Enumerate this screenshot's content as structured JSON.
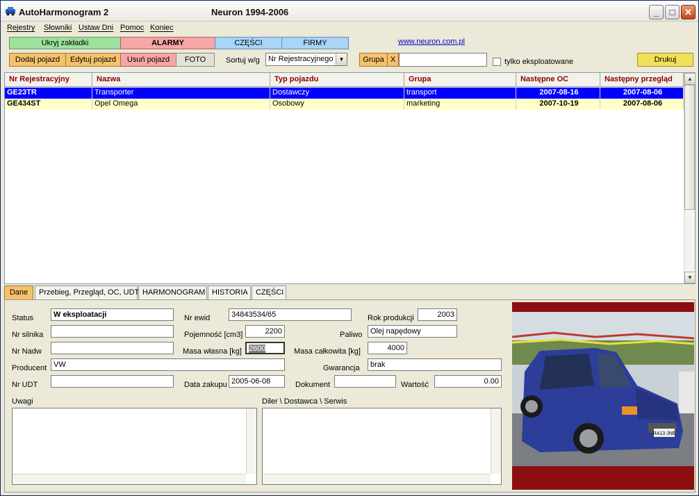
{
  "title": {
    "app": "AutoHarmonogram 2",
    "company": "Neuron 1994-2006"
  },
  "window_controls": {
    "minimize": "_",
    "maximize": "□",
    "close": "✕"
  },
  "menu": [
    "Rejestry",
    "Słowniki",
    "Ustaw Dni",
    "Pomoc",
    "Koniec"
  ],
  "top_buttons": {
    "hide_tabs": "Ukryj zakładki",
    "alarms": "ALARMY",
    "parts": "CZĘŚCI",
    "firms": "FIRMY"
  },
  "link": "www.neuron.com.pl",
  "toolbar": {
    "add": "Dodaj pojazd",
    "edit": "Edytuj pojazd",
    "delete": "Usuń pojazd",
    "photo": "FOTO",
    "sort_label": "Sortuj w/g",
    "sort_value": "Nr Rejestracyjnego",
    "group_button": "Grupa",
    "group_clear": "X",
    "group_value": "",
    "only_operated": "tylko eksploatowane",
    "print": "Drukuj"
  },
  "table": {
    "columns": [
      "Nr Rejestracyjny",
      "Nazwa",
      "Typ pojazdu",
      "Grupa",
      "Następne OC",
      "Następny przegląd"
    ],
    "rows": [
      [
        "GE23TR",
        "Transporter",
        "Dostawczy",
        "transport",
        "2007-08-16",
        "2007-08-06"
      ],
      [
        "GE434ST",
        "Opel Omega",
        "Osobowy",
        "marketing",
        "2007-10-19",
        "2007-08-06"
      ]
    ],
    "selected_row": 0
  },
  "tabs": [
    "Dane",
    "Przebieg, Przegląd, OC, UDT",
    "HARMONOGRAM",
    "HISTORIA",
    "CZĘŚCI"
  ],
  "active_tab": 0,
  "form": {
    "status_label": "Status",
    "status": "W eksploatacji",
    "nr_ewid_label": "Nr ewid",
    "nr_ewid": "34843534/65",
    "rok_label": "Rok produkcji",
    "rok": "2003",
    "nr_silnika_label": "Nr silnika",
    "nr_silnika": "",
    "pojemnosc_label": "Pojemność [cm3]",
    "pojemnosc": "2200",
    "paliwo_label": "Paliwo",
    "paliwo": "Olej napędowy",
    "nr_nadw_label": "Nr Nadw",
    "nr_nadw": "",
    "masa_wlasna_label": "Masa własna [kg]",
    "masa_wlasna": "2600",
    "masa_calk_label": "Masa całkowita [kg]",
    "masa_calk": "4000",
    "producent_label": "Producent",
    "producent": "VW",
    "gwarancja_label": "Gwarancja",
    "gwarancja": "brak",
    "nr_udt_label": "Nr UDT",
    "nr_udt": "",
    "data_zakupu_label": "Data zakupu",
    "data_zakupu": "2005-06-08",
    "dokument_label": "Dokument",
    "dokument": "",
    "wartosc_label": "Wartość",
    "wartosc": "0.00",
    "uwagi_label": "Uwagi",
    "diler_label": "Diler \\ Dostawca \\ Serwis"
  },
  "plate_text": "RA13 JNE",
  "colors": {
    "selected_row": "#0000ff",
    "alt_row": "#ffffc8",
    "header_text": "#8b0000",
    "photo_frame": "#8b0f10"
  }
}
